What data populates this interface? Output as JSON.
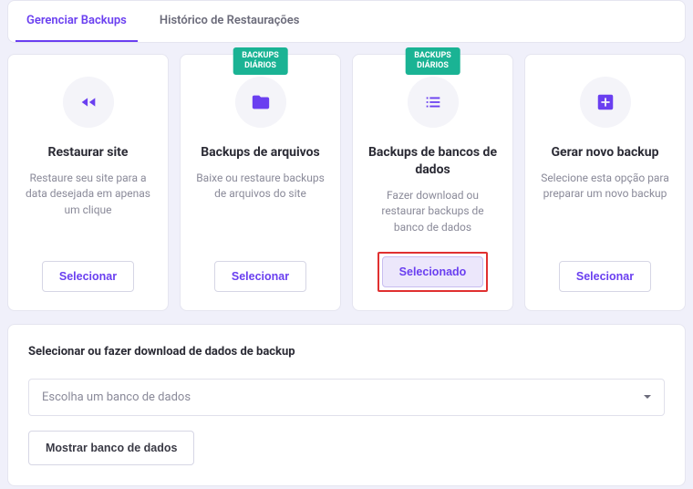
{
  "tabs": {
    "manage": "Gerenciar Backups",
    "history": "Histórico de Restaurações"
  },
  "badge_text": "BACKUPS\nDIÁRIOS",
  "cards": {
    "restore": {
      "title": "Restaurar site",
      "desc": "Restaure seu site para a data desejada em apenas um clique",
      "button": "Selecionar"
    },
    "files": {
      "title": "Backups de arquivos",
      "desc": "Baixe ou restaure backups de arquivos do site",
      "button": "Selecionar"
    },
    "db": {
      "title": "Backups de bancos de dados",
      "desc": "Fazer download ou restaurar backups de banco de dados",
      "button": "Selecionado"
    },
    "new": {
      "title": "Gerar novo backup",
      "desc": "Selecione esta opção para preparar um novo backup",
      "button": "Selecionar"
    }
  },
  "panel": {
    "title": "Selecionar ou fazer download de dados de backup",
    "select_placeholder": "Escolha um banco de dados",
    "show_button": "Mostrar banco de dados"
  }
}
